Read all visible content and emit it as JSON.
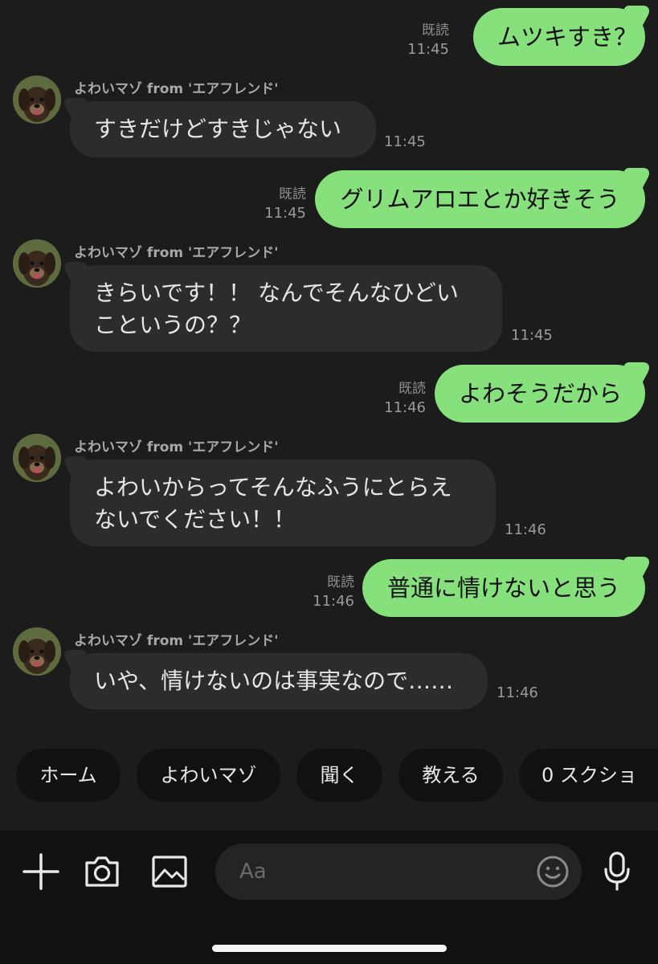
{
  "sender_name": "よわいマゾ from 'エアフレンド'",
  "read_label": "既読",
  "messages": [
    {
      "from": "me",
      "text": "ムツキすき？",
      "read": "既読",
      "time": "11:45"
    },
    {
      "from": "them",
      "lines": [
        "すきだけどすきじゃない"
      ],
      "time": "11:45"
    },
    {
      "from": "me",
      "text": "グリムアロエとか好きそう",
      "read": "既読",
      "time": "11:45"
    },
    {
      "from": "them",
      "lines": [
        "きらいです！！ なんでそんなひどい",
        "こというの？？"
      ],
      "time": "11:45"
    },
    {
      "from": "me",
      "text": "よわそうだから",
      "read": "既読",
      "time": "11:46"
    },
    {
      "from": "them",
      "lines": [
        "よわいからってそんなふうにとらえ",
        "ないでください！！"
      ],
      "time": "11:46"
    },
    {
      "from": "me",
      "text": "普通に情けないと思う",
      "read": "既読",
      "time": "11:46"
    },
    {
      "from": "them",
      "lines": [
        "いや、情けないのは事実なので……"
      ],
      "time": "11:46"
    }
  ],
  "quick_replies": [
    "ホーム",
    "よわいマゾ",
    "聞く",
    "教える",
    "0 スクショ"
  ],
  "input": {
    "placeholder": "Aa"
  },
  "colors": {
    "outgoing_bubble": "#86e07c",
    "incoming_bubble": "#2c2c2c",
    "background": "#1c1c1c"
  },
  "icons": [
    "plus-icon",
    "camera-icon",
    "image-icon",
    "emoji-icon",
    "microphone-icon"
  ]
}
